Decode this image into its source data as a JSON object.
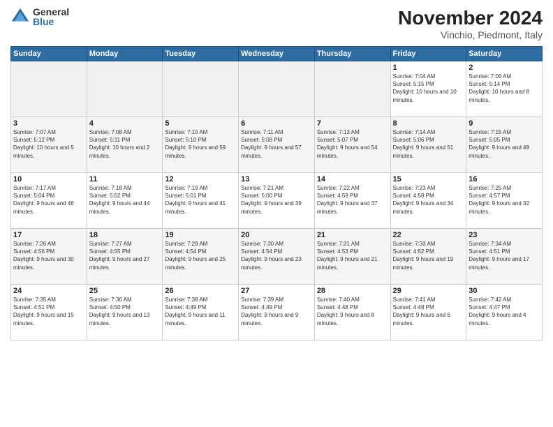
{
  "header": {
    "logo_general": "General",
    "logo_blue": "Blue",
    "month_title": "November 2024",
    "location": "Vinchio, Piedmont, Italy"
  },
  "weekdays": [
    "Sunday",
    "Monday",
    "Tuesday",
    "Wednesday",
    "Thursday",
    "Friday",
    "Saturday"
  ],
  "weeks": [
    [
      {
        "day": "",
        "info": ""
      },
      {
        "day": "",
        "info": ""
      },
      {
        "day": "",
        "info": ""
      },
      {
        "day": "",
        "info": ""
      },
      {
        "day": "",
        "info": ""
      },
      {
        "day": "1",
        "info": "Sunrise: 7:04 AM\nSunset: 5:15 PM\nDaylight: 10 hours and 10 minutes."
      },
      {
        "day": "2",
        "info": "Sunrise: 7:06 AM\nSunset: 5:14 PM\nDaylight: 10 hours and 8 minutes."
      }
    ],
    [
      {
        "day": "3",
        "info": "Sunrise: 7:07 AM\nSunset: 5:12 PM\nDaylight: 10 hours and 5 minutes."
      },
      {
        "day": "4",
        "info": "Sunrise: 7:08 AM\nSunset: 5:11 PM\nDaylight: 10 hours and 2 minutes."
      },
      {
        "day": "5",
        "info": "Sunrise: 7:10 AM\nSunset: 5:10 PM\nDaylight: 9 hours and 59 minutes."
      },
      {
        "day": "6",
        "info": "Sunrise: 7:11 AM\nSunset: 5:08 PM\nDaylight: 9 hours and 57 minutes."
      },
      {
        "day": "7",
        "info": "Sunrise: 7:13 AM\nSunset: 5:07 PM\nDaylight: 9 hours and 54 minutes."
      },
      {
        "day": "8",
        "info": "Sunrise: 7:14 AM\nSunset: 5:06 PM\nDaylight: 9 hours and 51 minutes."
      },
      {
        "day": "9",
        "info": "Sunrise: 7:15 AM\nSunset: 5:05 PM\nDaylight: 9 hours and 49 minutes."
      }
    ],
    [
      {
        "day": "10",
        "info": "Sunrise: 7:17 AM\nSunset: 5:04 PM\nDaylight: 9 hours and 46 minutes."
      },
      {
        "day": "11",
        "info": "Sunrise: 7:18 AM\nSunset: 5:02 PM\nDaylight: 9 hours and 44 minutes."
      },
      {
        "day": "12",
        "info": "Sunrise: 7:19 AM\nSunset: 5:01 PM\nDaylight: 9 hours and 41 minutes."
      },
      {
        "day": "13",
        "info": "Sunrise: 7:21 AM\nSunset: 5:00 PM\nDaylight: 9 hours and 39 minutes."
      },
      {
        "day": "14",
        "info": "Sunrise: 7:22 AM\nSunset: 4:59 PM\nDaylight: 9 hours and 37 minutes."
      },
      {
        "day": "15",
        "info": "Sunrise: 7:23 AM\nSunset: 4:58 PM\nDaylight: 9 hours and 34 minutes."
      },
      {
        "day": "16",
        "info": "Sunrise: 7:25 AM\nSunset: 4:57 PM\nDaylight: 9 hours and 32 minutes."
      }
    ],
    [
      {
        "day": "17",
        "info": "Sunrise: 7:26 AM\nSunset: 4:56 PM\nDaylight: 9 hours and 30 minutes."
      },
      {
        "day": "18",
        "info": "Sunrise: 7:27 AM\nSunset: 4:55 PM\nDaylight: 9 hours and 27 minutes."
      },
      {
        "day": "19",
        "info": "Sunrise: 7:29 AM\nSunset: 4:54 PM\nDaylight: 9 hours and 25 minutes."
      },
      {
        "day": "20",
        "info": "Sunrise: 7:30 AM\nSunset: 4:54 PM\nDaylight: 9 hours and 23 minutes."
      },
      {
        "day": "21",
        "info": "Sunrise: 7:31 AM\nSunset: 4:53 PM\nDaylight: 9 hours and 21 minutes."
      },
      {
        "day": "22",
        "info": "Sunrise: 7:33 AM\nSunset: 4:52 PM\nDaylight: 9 hours and 19 minutes."
      },
      {
        "day": "23",
        "info": "Sunrise: 7:34 AM\nSunset: 4:51 PM\nDaylight: 9 hours and 17 minutes."
      }
    ],
    [
      {
        "day": "24",
        "info": "Sunrise: 7:35 AM\nSunset: 4:51 PM\nDaylight: 9 hours and 15 minutes."
      },
      {
        "day": "25",
        "info": "Sunrise: 7:36 AM\nSunset: 4:50 PM\nDaylight: 9 hours and 13 minutes."
      },
      {
        "day": "26",
        "info": "Sunrise: 7:38 AM\nSunset: 4:49 PM\nDaylight: 9 hours and 11 minutes."
      },
      {
        "day": "27",
        "info": "Sunrise: 7:39 AM\nSunset: 4:49 PM\nDaylight: 9 hours and 9 minutes."
      },
      {
        "day": "28",
        "info": "Sunrise: 7:40 AM\nSunset: 4:48 PM\nDaylight: 9 hours and 8 minutes."
      },
      {
        "day": "29",
        "info": "Sunrise: 7:41 AM\nSunset: 4:48 PM\nDaylight: 9 hours and 6 minutes."
      },
      {
        "day": "30",
        "info": "Sunrise: 7:42 AM\nSunset: 4:47 PM\nDaylight: 9 hours and 4 minutes."
      }
    ]
  ]
}
